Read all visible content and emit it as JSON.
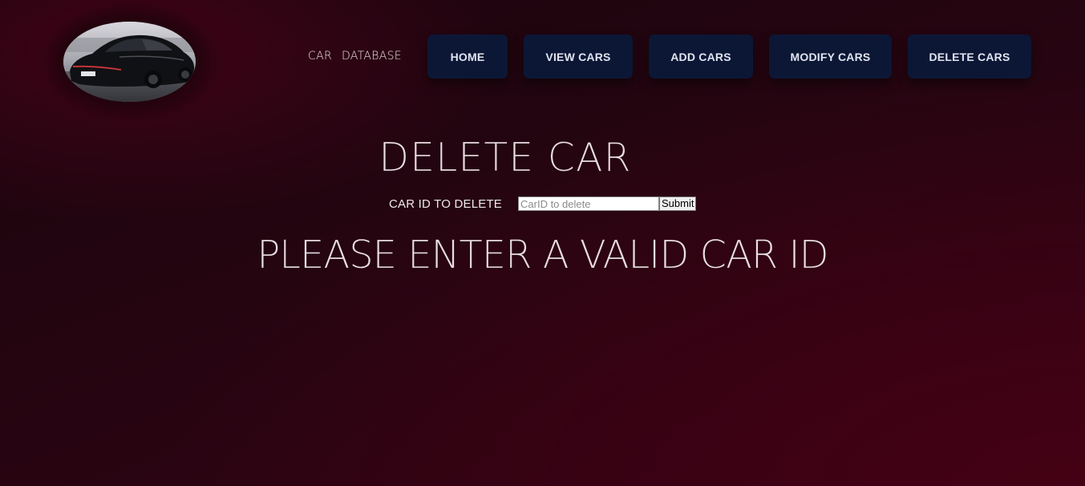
{
  "brand": {
    "word1": "CAR",
    "word2": "DATABASE"
  },
  "nav": {
    "home": "HOME",
    "view_cars": "VIEW CARS",
    "add_cars": "ADD CARS",
    "modify_cars": "MODIFY CARS",
    "delete_cars": "DELETE CARS"
  },
  "main": {
    "title": "DELETE CAR",
    "form_label": "CAR ID TO DELETE",
    "input_placeholder": "CarID to delete",
    "input_value": "",
    "submit_label": "Submit",
    "message": "PLEASE ENTER A VALID CAR ID"
  },
  "colors": {
    "nav_button_bg": "#0c1736",
    "page_bg": "#2a0410"
  },
  "icons": {
    "logo": "car-photo-logo"
  }
}
